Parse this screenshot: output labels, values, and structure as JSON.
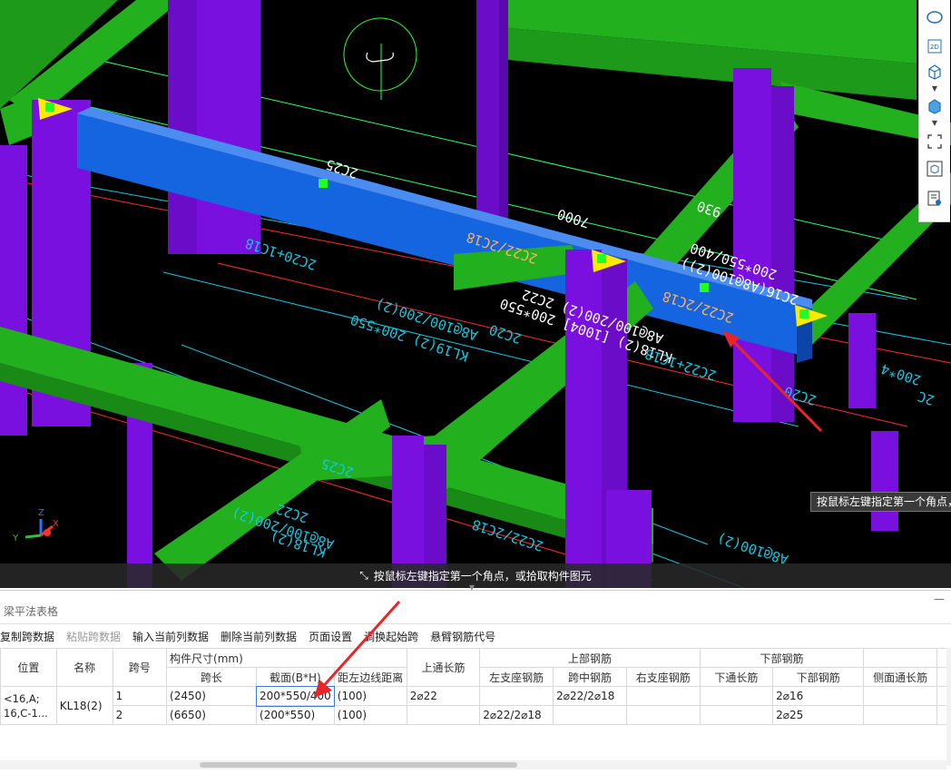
{
  "viewport": {
    "annotations": {
      "span_top": "2C25",
      "span_length": "7000",
      "span_930": "930",
      "beam_main": "KL18(2) [1004] 200*550",
      "beam_stirrup": "A8@100/200(2) 2C22",
      "beam_detail1": "2C16(A8@100(2))",
      "beam_detail2": "200*550/400",
      "rebar_left": "2C22/2C18",
      "rebar_right": "2C22/2C18",
      "left_rebar": "2C20+1C18",
      "kl19": "KL19(2) 200*550",
      "kl19_stirrup": "A8@100/200(2)",
      "c2c20": "2C20",
      "right_1c18": "2C22+1C18",
      "right_c20": "2C20",
      "bottom_2c25": "2C25",
      "bottom_2c22": "2C22",
      "bottom_a8": "A8@100/200(2)",
      "bottom_kl18": "KL18(2)",
      "bottom_2c18": "2C22/2C18",
      "bottom_a8b": "A8@100(2)",
      "right_200": "200*4",
      "right_2c": "2C"
    },
    "status_text": "按鼠标左键指定第一个角点，或拾取构件图元",
    "hint_right": "按鼠标左键指定第一个角点，"
  },
  "right_toolbar": {
    "icons": [
      "shape-icon",
      "2d-icon",
      "box-3d-icon",
      "box-3d-filled-icon",
      "select-frame-icon",
      "cube-view-icon",
      "properties-icon"
    ]
  },
  "panel": {
    "title": "梁平法表格",
    "toolbar": [
      {
        "label": "复制跨数据",
        "enabled": true
      },
      {
        "label": "粘贴跨数据",
        "enabled": false
      },
      {
        "label": "输入当前列数据",
        "enabled": true
      },
      {
        "label": "删除当前列数据",
        "enabled": true
      },
      {
        "label": "页面设置",
        "enabled": true
      },
      {
        "label": "调换起始跨",
        "enabled": true
      },
      {
        "label": "悬臂钢筋代号",
        "enabled": true
      }
    ],
    "headers": {
      "position": "位置",
      "name": "名称",
      "span_no": "跨号",
      "size_group": "构件尺寸(mm)",
      "span_len": "跨长",
      "section": "截面(B*H)",
      "offset": "距左边线距离",
      "top_through": "上通长筋",
      "top_group": "上部钢筋",
      "left_support": "左支座钢筋",
      "mid_span": "跨中钢筋",
      "right_support": "右支座钢筋",
      "bottom_group": "下部钢筋",
      "bottom_through": "下通长筋",
      "bottom_rebar": "下部钢筋",
      "side_through": "侧面通长筋"
    },
    "position_value": "<16,A;\n16,C-1...",
    "position_line1": "<16,A;",
    "position_line2": "16,C-1...",
    "name_value": "KL18(2)",
    "rows": [
      {
        "span_no": "1",
        "span_len": "(2450)",
        "section": "200*550/400",
        "offset": "(100)",
        "top_through": "2⌀22",
        "left_support": "",
        "mid_span": "2⌀22/2⌀18",
        "right_support": "",
        "bottom_through": "",
        "bottom_rebar": "2⌀16",
        "side_through": ""
      },
      {
        "span_no": "2",
        "span_len": "(6650)",
        "section": "(200*550)",
        "offset": "(100)",
        "top_through": "",
        "left_support": "2⌀22/2⌀18",
        "mid_span": "",
        "right_support": "",
        "bottom_through": "",
        "bottom_rebar": "2⌀25",
        "side_through": ""
      }
    ]
  },
  "colors": {
    "beam_green": "#22b01e",
    "column_purple": "#7a10e0",
    "selected_beam": "#1565e0",
    "axis_cyan": "#14c8e0",
    "axis_red": "#ff2020",
    "arrow_red": "#e8262a"
  }
}
